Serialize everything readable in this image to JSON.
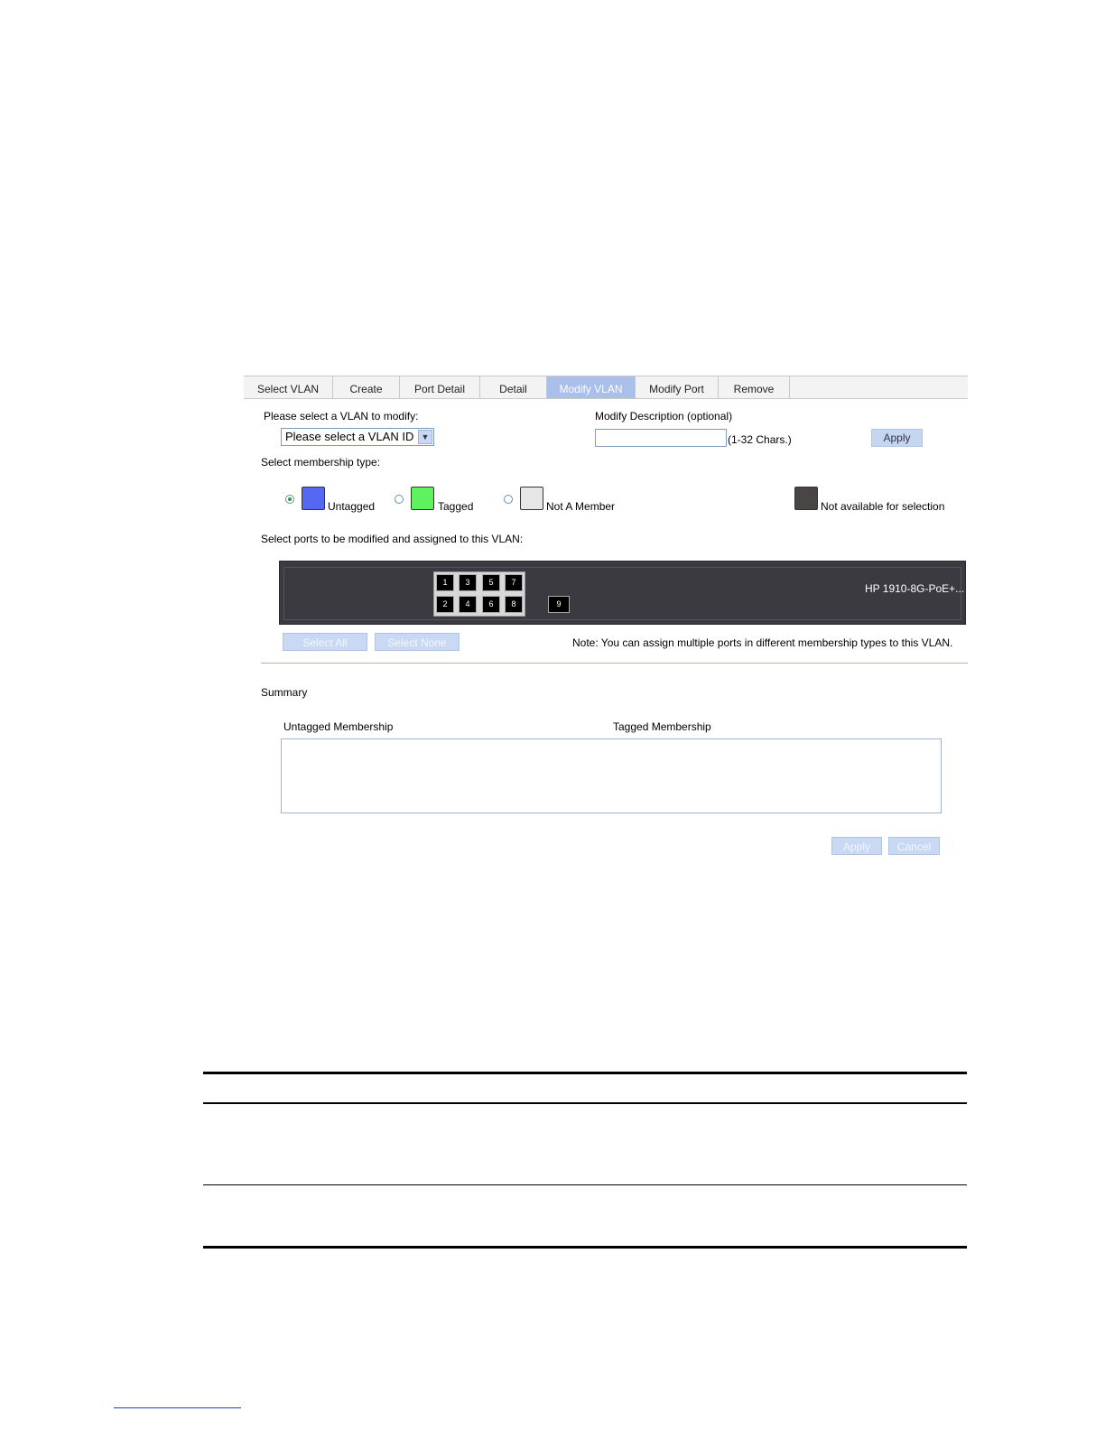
{
  "tabs": [
    {
      "label": "Select VLAN",
      "active": false
    },
    {
      "label": "Create",
      "active": false
    },
    {
      "label": "Port Detail",
      "active": false
    },
    {
      "label": "Detail",
      "active": false
    },
    {
      "label": "Modify VLAN",
      "active": true
    },
    {
      "label": "Modify Port",
      "active": false
    },
    {
      "label": "Remove",
      "active": false
    }
  ],
  "vlan_select": {
    "label": "Please select a VLAN to modify:",
    "value": "Please select a VLAN ID"
  },
  "description": {
    "label": "Modify Description (optional)",
    "value": "",
    "hint": "(1-32 Chars.)",
    "apply_label": "Apply"
  },
  "membership": {
    "label": "Select membership type:",
    "selected": "Untagged",
    "options": [
      {
        "label": "Untagged",
        "color": "#5468f2"
      },
      {
        "label": "Tagged",
        "color": "#5ef25e"
      },
      {
        "label": "Not A Member",
        "color": "#e6e6e6"
      }
    ],
    "unavailable": {
      "label": "Not available for selection",
      "color": "#4a4545"
    }
  },
  "ports": {
    "label": "Select ports to be modified and assigned to this VLAN:",
    "top_row": [
      "1",
      "3",
      "5",
      "7"
    ],
    "bottom_row": [
      "2",
      "4",
      "6",
      "8"
    ],
    "extra": "9",
    "model": "HP 1910-8G-PoE+...",
    "select_all_label": "Select All",
    "select_none_label": "Select None",
    "note": "Note: You can assign multiple ports in different membership types to this VLAN."
  },
  "summary": {
    "title": "Summary",
    "untagged_header": "Untagged Membership",
    "tagged_header": "Tagged Membership"
  },
  "footer_buttons": {
    "apply_label": "Apply",
    "cancel_label": "Cancel"
  }
}
